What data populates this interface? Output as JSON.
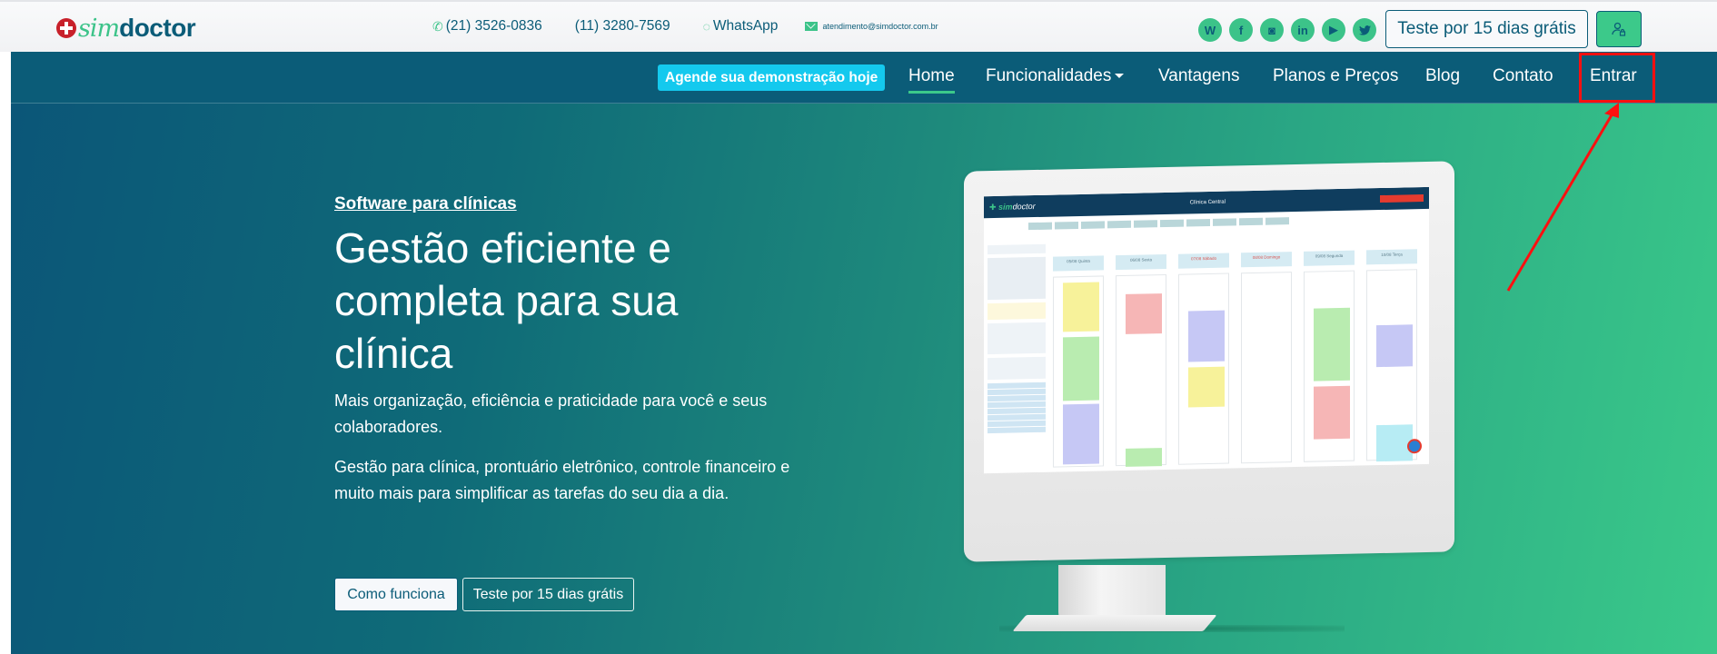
{
  "topbar": {
    "logo": {
      "part1": "sim",
      "part2": "doctor"
    },
    "contacts": [
      {
        "icon": "phone-icon",
        "text": "(21) 3526-0836"
      },
      {
        "icon": "",
        "text": "(11) 3280-7569"
      },
      {
        "icon": "whatsapp-icon",
        "text": "WhatsApp"
      },
      {
        "icon": "mail-icon",
        "text": "atendimento@simdoctor.com.br"
      }
    ],
    "socials": [
      {
        "name": "wordpress-icon",
        "glyph": "W"
      },
      {
        "name": "facebook-icon",
        "glyph": "f"
      },
      {
        "name": "instagram-icon",
        "glyph": "◙"
      },
      {
        "name": "linkedin-icon",
        "glyph": "in"
      },
      {
        "name": "youtube-icon",
        "glyph": "▶"
      },
      {
        "name": "twitter-icon",
        "glyph": "🐦"
      }
    ],
    "trial_button": "Teste por 15 dias grátis",
    "login_icon": "user-lock-icon"
  },
  "nav": {
    "demo_button": "Agende sua demonstração hoje",
    "items": [
      {
        "label": "Home",
        "active": true
      },
      {
        "label": "Funcionalidades",
        "dropdown": true
      },
      {
        "label": "Vantagens"
      },
      {
        "label": "Planos e Preços"
      },
      {
        "label": "Blog"
      },
      {
        "label": "Contato"
      },
      {
        "label": "Entrar"
      }
    ]
  },
  "hero": {
    "eyebrow": "Software para clínicas",
    "headline": "Gestão eficiente e completa para sua clínica",
    "lead": "Mais organização, eficiência e praticidade para você e seus colaboradores.",
    "lead2": "Gestão para clínica, prontuário eletrônico, controle financeiro e muito mais para simplificar as tarefas do seu dia a dia.",
    "buttons": {
      "how": "Como funciona",
      "trial": "Teste por 15 dias grátis"
    }
  },
  "illustration": {
    "app_title": "Clínica Central",
    "days": [
      {
        "date": "05/08",
        "weekday": "Quinta"
      },
      {
        "date": "06/08",
        "weekday": "Sexta"
      },
      {
        "date": "07/08",
        "weekday": "Sábado"
      },
      {
        "date": "08/08",
        "weekday": "Domingo"
      },
      {
        "date": "09/08",
        "weekday": "Segunda"
      },
      {
        "date": "10/08",
        "weekday": "Terça"
      }
    ]
  },
  "annotation": {
    "target": "Entrar",
    "color": "#ff1010"
  },
  "colors": {
    "brand_dark": "#0b5c78",
    "brand_green": "#3cc98a",
    "demo_cyan": "#14c9ee",
    "logo_red": "#c8202a"
  }
}
